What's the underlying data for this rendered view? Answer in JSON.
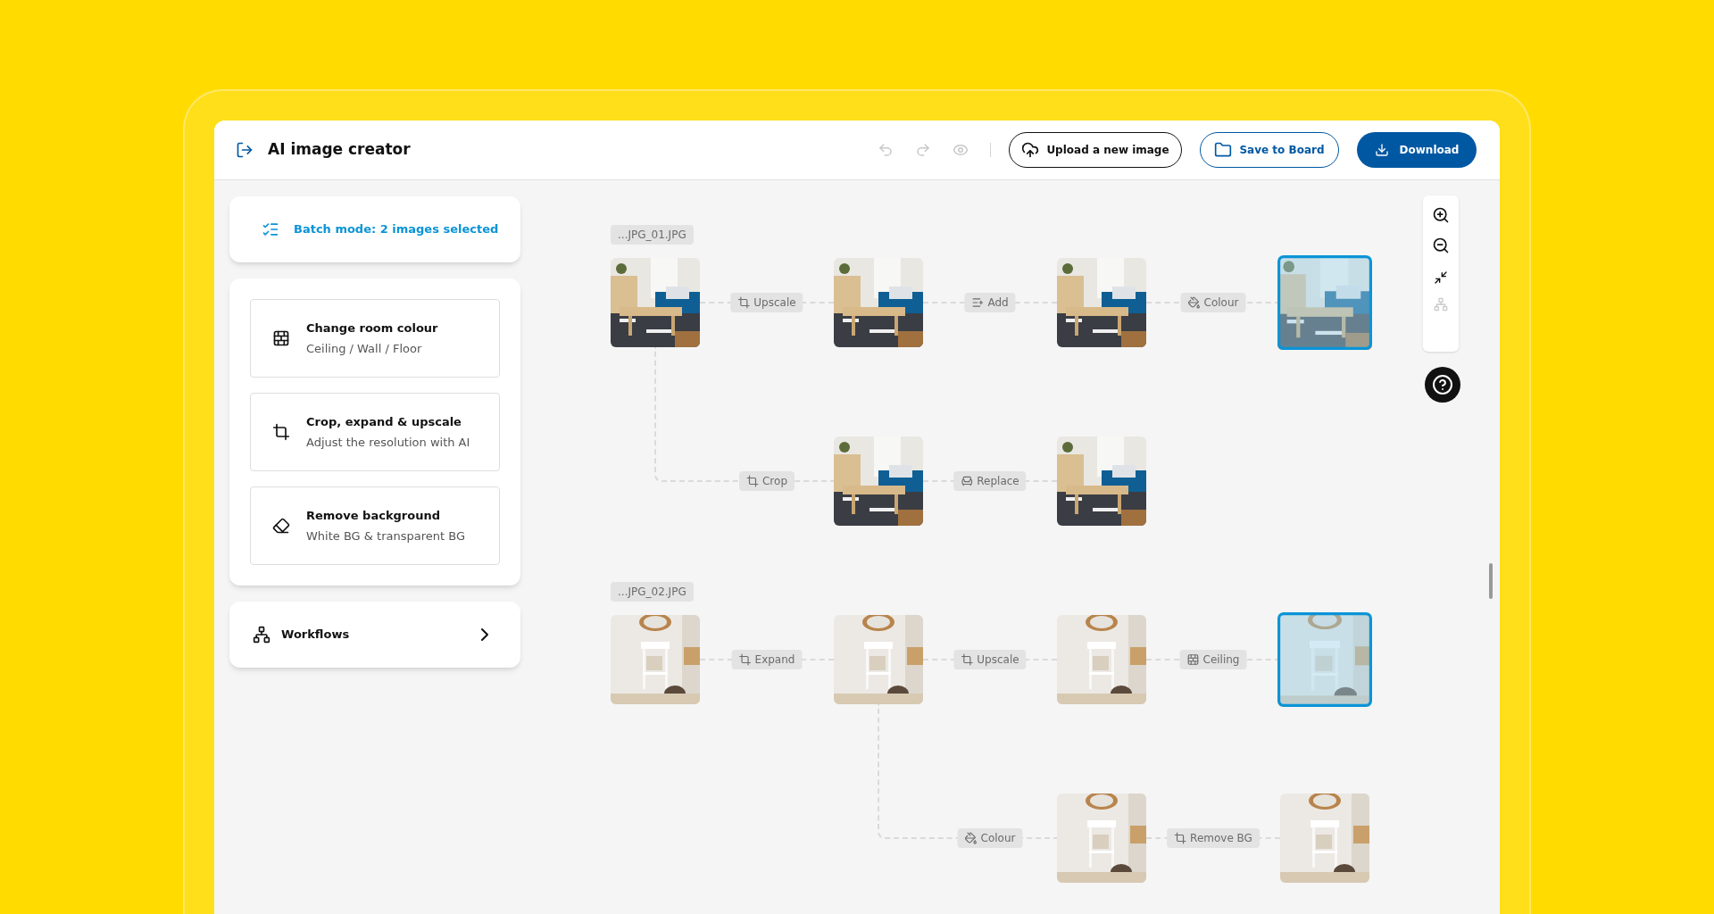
{
  "header": {
    "title": "AI image creator",
    "upload_button": "Upload a new image",
    "save_button": "Save to Board",
    "download_button": "Download"
  },
  "sidebar": {
    "batch_mode": "Batch mode: 2 images selected",
    "tools": [
      {
        "kind": "wall",
        "title": "Change room colour",
        "subtitle": "Ceiling / Wall / Floor"
      },
      {
        "kind": "crop",
        "title": "Crop, expand & upscale",
        "subtitle": "Adjust the resolution with AI"
      },
      {
        "kind": "eraser",
        "title": "Remove background",
        "subtitle": "White BG & transparent BG"
      }
    ],
    "workflows": "Workflows"
  },
  "canvas": {
    "groups": [
      {
        "file": "...JPG_01.JPG",
        "root": {
          "selected": false,
          "steps": [
            {
              "kind": "crop",
              "label": "Upscale",
              "node": {
                "selected": false,
                "steps": [
                  {
                    "kind": "add",
                    "label": "Add",
                    "node": {
                      "selected": false,
                      "steps": [
                        {
                          "kind": "colour",
                          "label": "Colour",
                          "node": {
                            "selected": true
                          }
                        }
                      ]
                    }
                  }
                ]
              }
            },
            {
              "kind": "crop",
              "label": "Crop",
              "node": {
                "selected": false,
                "steps": [
                  {
                    "kind": "replace",
                    "label": "Replace",
                    "node": {
                      "selected": false
                    }
                  }
                ]
              }
            }
          ]
        }
      },
      {
        "file": "...JPG_02.JPG",
        "root": {
          "selected": false,
          "steps": [
            {
              "kind": "crop",
              "label": "Expand",
              "node": {
                "selected": false,
                "steps": [
                  {
                    "kind": "crop",
                    "label": "Upscale",
                    "node": {
                      "selected": false,
                      "steps": [
                        {
                          "kind": "wall",
                          "label": "Ceiling",
                          "node": {
                            "selected": true
                          }
                        }
                      ]
                    }
                  },
                  {
                    "kind": "colour",
                    "label": "Colour",
                    "node": {
                      "selected": false,
                      "steps": [
                        {
                          "kind": "crop",
                          "label": "Remove BG",
                          "node": {
                            "selected": false
                          }
                        }
                      ]
                    }
                  }
                ]
              }
            }
          ]
        }
      }
    ]
  }
}
